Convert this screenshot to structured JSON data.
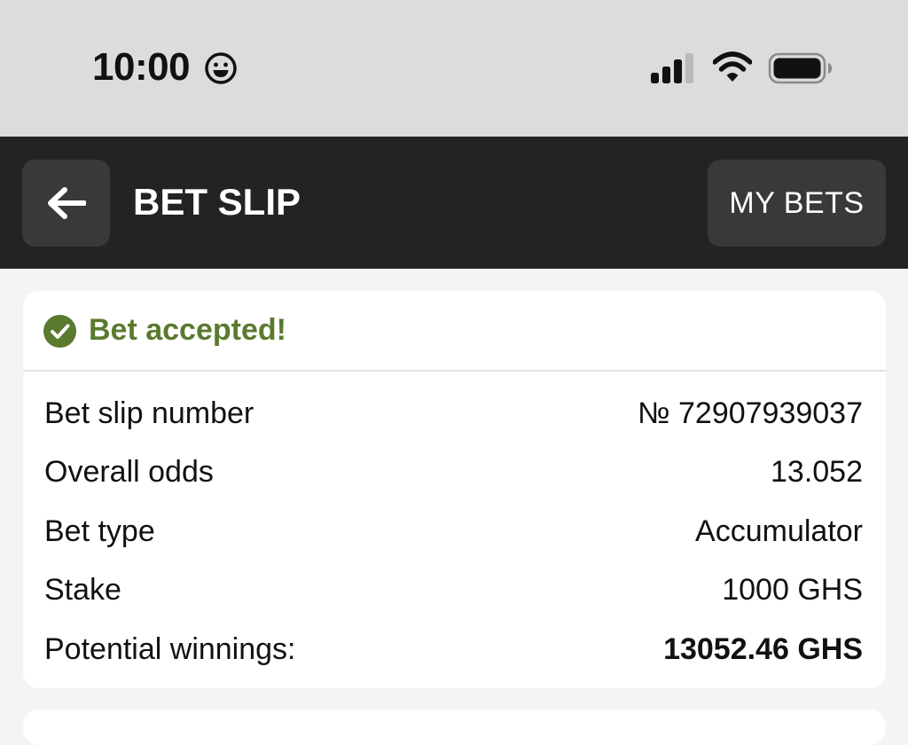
{
  "status_bar": {
    "time": "10:00"
  },
  "header": {
    "title": "BET SLIP",
    "my_bets_label": "MY BETS"
  },
  "bet": {
    "status": "Bet accepted!",
    "rows": [
      {
        "label": "Bet slip number",
        "value": "№ 72907939037"
      },
      {
        "label": "Overall odds",
        "value": "13.052"
      },
      {
        "label": "Bet type",
        "value": "Accumulator"
      },
      {
        "label": "Stake",
        "value": "1000 GHS"
      },
      {
        "label": "Potential winnings:",
        "value": "13052.46 GHS"
      }
    ]
  },
  "colors": {
    "header_bg": "#242223",
    "button_bg": "#3a3838",
    "success": "#5a7a2e",
    "status_bar_bg": "#dcdcdc",
    "page_bg": "#f6f3f4"
  },
  "icons": [
    "smiley-icon",
    "signal-icon",
    "wifi-icon",
    "battery-icon",
    "back-arrow-icon",
    "check-circle-icon"
  ]
}
